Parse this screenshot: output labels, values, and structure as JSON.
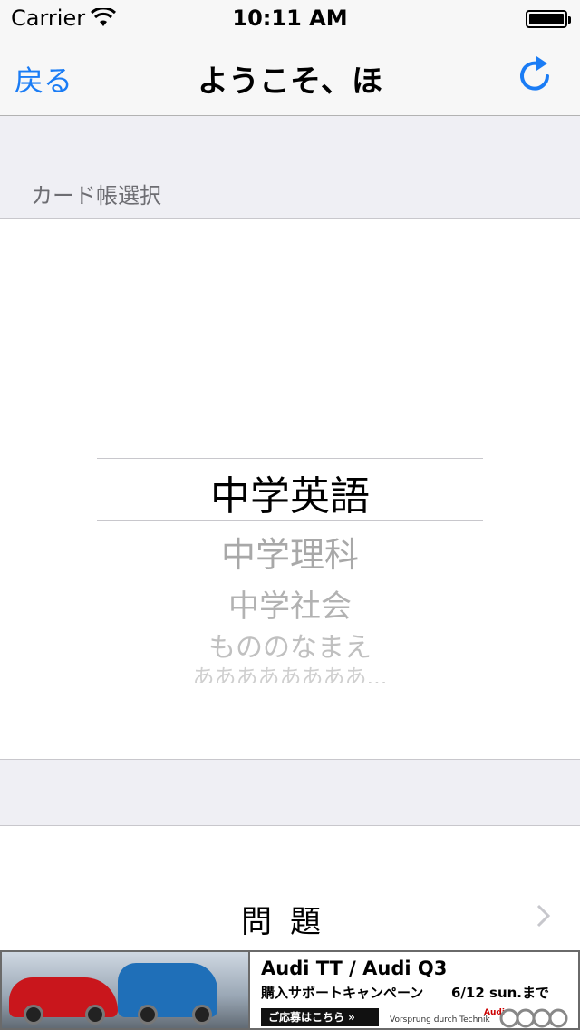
{
  "status_bar": {
    "carrier": "Carrier",
    "time": "10:11 AM"
  },
  "nav": {
    "back_label": "戻る",
    "title": "ようこそ、ほ",
    "refresh_icon": "refresh-icon"
  },
  "section": {
    "header": "カード帳選択"
  },
  "picker": {
    "selected": "中学英語",
    "items": [
      "中学理科",
      "中学社会",
      "もののなまえ",
      "ああああああああ..."
    ]
  },
  "question_cell": {
    "label": "問題"
  },
  "ad": {
    "title": "Audi TT / Audi Q3",
    "subtitle": "購入サポートキャンペーン",
    "date": "6/12 sun.まで",
    "cta": "ご応募はこちら »",
    "tagline": "Vorsprung durch Technik",
    "brand": "Audi"
  },
  "colors": {
    "accent": "#1a7cf5",
    "background": "#efeff4",
    "ad_red_car": "#c9161c",
    "ad_blue_car": "#1f6fb8"
  }
}
